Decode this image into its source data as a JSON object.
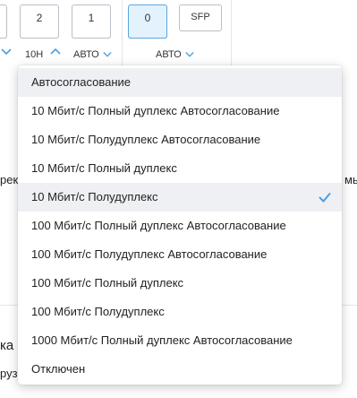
{
  "ports": [
    {
      "label": "2",
      "selected": false
    },
    {
      "label": "1",
      "selected": false
    },
    {
      "label": "0",
      "selected": true
    }
  ],
  "sfp_label": "SFP",
  "speed_labels": {
    "current": "10H",
    "auto1": "АВТО",
    "auto2": "АВТО"
  },
  "background_fragments": {
    "left_mid": "рек.",
    "right_mid": "мь",
    "left_lower1": "ка",
    "left_lower2": "руз"
  },
  "dropdown": {
    "options": [
      "Автосогласование",
      "10 Мбит/с Полный дуплекс Автосогласование",
      "10 Мбит/с Полудуплекс Автосогласование",
      "10 Мбит/с Полный дуплекс",
      "10 Мбит/с Полудуплекс",
      "100 Мбит/с Полный дуплекс Автосогласование",
      "100 Мбит/с Полудуплекс Автосогласование",
      "100 Мбит/с Полный дуплекс",
      "100 Мбит/с Полудуплекс",
      "1000 Мбит/с Полный дуплекс Автосогласование",
      "Отключен"
    ],
    "selected_index": 4,
    "hover_index": 0
  },
  "colors": {
    "accent": "#4b9fe1",
    "selected_port_bg": "#e3f2fd",
    "row_highlight": "#eef0f3"
  }
}
